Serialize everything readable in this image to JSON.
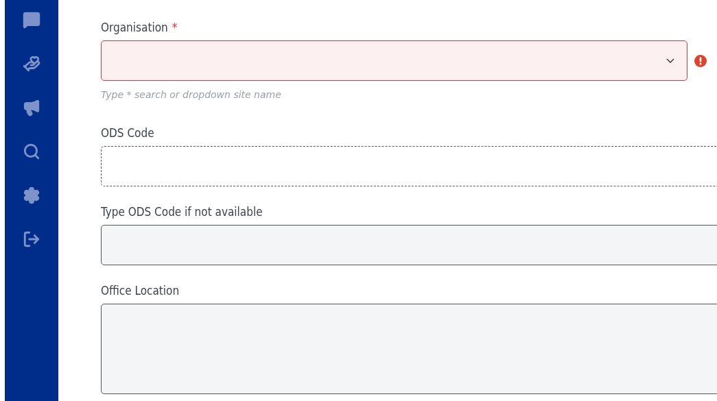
{
  "sidebar": {
    "items": [
      {
        "kind": "message"
      },
      {
        "kind": "helping"
      },
      {
        "kind": "megaphone"
      },
      {
        "kind": "search"
      },
      {
        "kind": "settings"
      },
      {
        "kind": "logout"
      }
    ]
  },
  "form": {
    "fields": [
      {
        "label": "Organisation",
        "required_mark": "*",
        "kind": "select",
        "invalid": true,
        "hint": "Type * search or dropdown site name"
      },
      {
        "label": "ODS Code",
        "kind": "dashed",
        "invalid": false
      },
      {
        "label": "Type ODS Code if not available",
        "kind": "text",
        "invalid": false
      },
      {
        "label": "Office Location",
        "kind": "textarea",
        "invalid": false
      }
    ]
  }
}
